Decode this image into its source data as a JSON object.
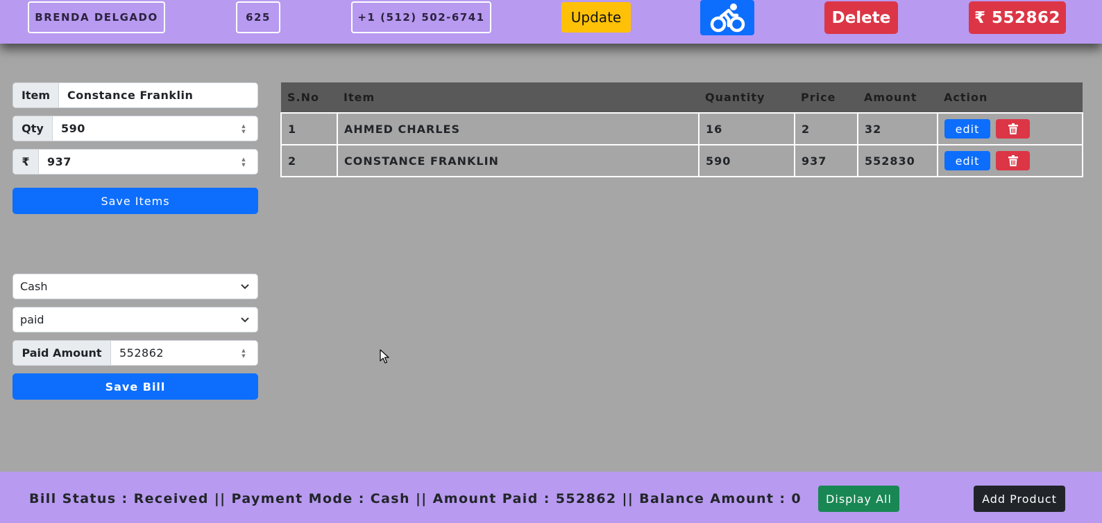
{
  "header": {
    "customer_name": "BRENDA DELGADO",
    "bill_number": "625",
    "phone": "+1 (512) 502-6741",
    "update_label": "Update",
    "delivery_icon": "bicycle-icon",
    "delete_label": "Delete",
    "total": "₹ 552862"
  },
  "item_form": {
    "item_label": "Item",
    "item_value": "Constance Franklin",
    "qty_label": "Qty",
    "qty_value": "590",
    "price_label": "₹",
    "price_value": "937",
    "save_items_label": "Save Items"
  },
  "bill_form": {
    "payment_mode": "Cash",
    "payment_status": "paid",
    "paid_amount_label": "Paid Amount",
    "paid_amount_value": "552862",
    "save_bill_label": "Save Bill"
  },
  "table": {
    "headers": [
      "S.No",
      "Item",
      "Quantity",
      "Price",
      "Amount",
      "Action"
    ],
    "rows": [
      {
        "sno": "1",
        "item": "AHMED CHARLES",
        "qty": "16",
        "price": "2",
        "amount": "32",
        "edit": "edit"
      },
      {
        "sno": "2",
        "item": "CONSTANCE FRANKLIN",
        "qty": "590",
        "price": "937",
        "amount": "552830",
        "edit": "edit"
      }
    ]
  },
  "footer": {
    "status_text": "Bill Status : Received || Payment Mode : Cash || Amount Paid : 552862 || Balance Amount : 0",
    "display_all_label": "Display All",
    "add_product_label": "Add Product"
  },
  "colors": {
    "bar": "#b89af0",
    "background": "#a6a6a6",
    "primary": "#0d6efd",
    "danger": "#dc3545",
    "warning": "#ffc107",
    "success": "#198754",
    "dark": "#212529"
  }
}
